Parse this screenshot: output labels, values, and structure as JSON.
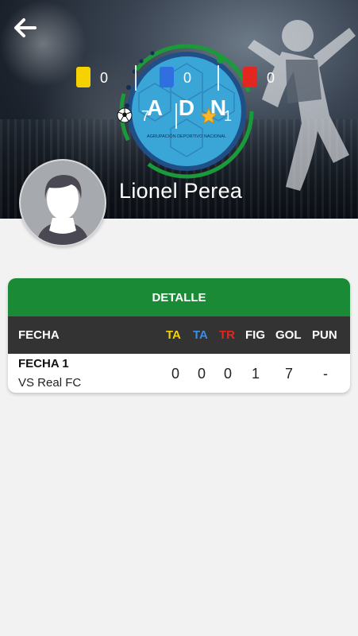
{
  "header": {
    "player_name": "Lionel Perea",
    "stats": {
      "yellow_cards": "0",
      "blue_cards": "0",
      "red_cards": "0",
      "goals": "7",
      "mvp": "1"
    },
    "logo": {
      "letters": [
        "A",
        "D",
        "N"
      ],
      "tagline": "AGRUPACIÓN DEPORTIVO NACIONAL"
    },
    "icons": {
      "back": "arrow-left-icon",
      "goals": "soccer-ball-icon",
      "mvp": "star-icon"
    }
  },
  "detail": {
    "title": "DETALLE",
    "columns": {
      "fecha": "FECHA",
      "ta_yellow": "TA",
      "ta_blue": "TA",
      "tr": "TR",
      "fig": "FIG",
      "gol": "GOL",
      "pun": "PUN"
    },
    "rows": [
      {
        "fecha": "FECHA 1",
        "opponent": "VS Real FC",
        "ta_yellow": "0",
        "ta_blue": "0",
        "tr": "0",
        "fig": "1",
        "gol": "7",
        "pun": "-"
      }
    ]
  },
  "colors": {
    "yellow": "#f5d200",
    "blue": "#2f6fe0",
    "red": "#e3261f",
    "green": "#1b8a36",
    "dark_header": "#333333"
  }
}
